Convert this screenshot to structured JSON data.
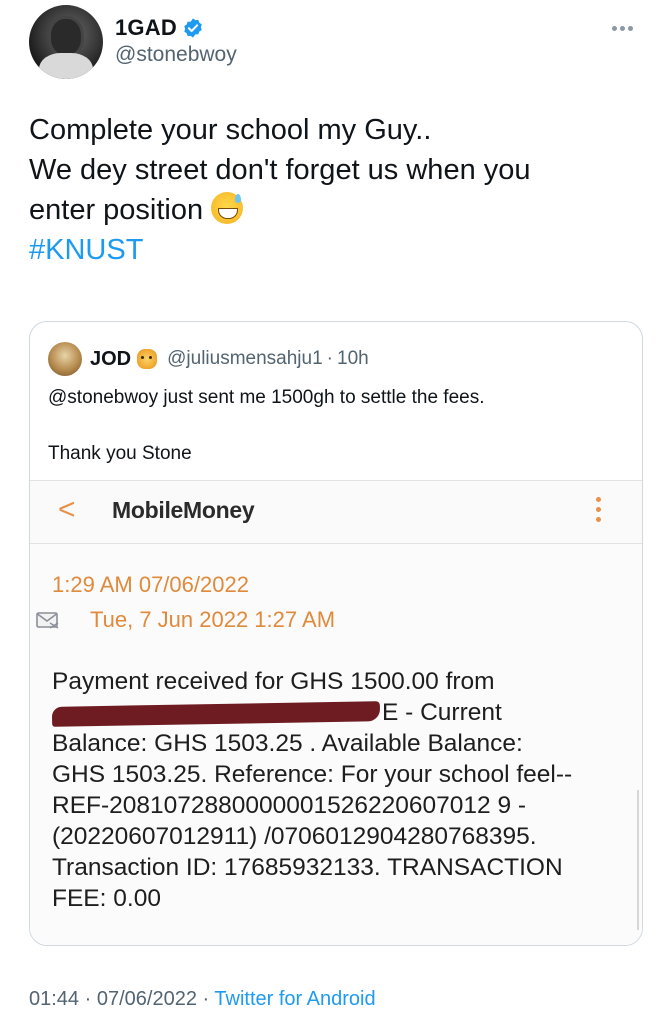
{
  "author": {
    "name": "1GAD",
    "handle": "@stonebwoy"
  },
  "tweet": {
    "lines": [
      "Complete your school my Guy..",
      "We dey street don't forget us when you",
      "enter position"
    ],
    "hashtag": "#KNUST"
  },
  "quoted": {
    "name": "JOD",
    "handle": "@juliusmensahju1",
    "separator": "·",
    "time": "10h",
    "text_line1": "@stonebwoy just sent me 1500gh to settle the fees.",
    "text_line2": "Thank you Stone",
    "sms": {
      "back_glyph": "<",
      "app_title": "MobileMoney",
      "received_datetime": "1:29 AM  07/06/2022",
      "sent_datetime": "Tue, 7 Jun 2022 1:27 AM",
      "body_lines": [
        "Payment received for  GHS 1500.00 from",
        "E -  Current",
        "Balance: GHS 1503.25 . Available Balance:",
        "GHS 1503.25. Reference: For your school feel--",
        "REF-2081072880000001526220607012 9 -",
        "(20220607012911) /0706012904280768395.",
        "Transaction ID: 17685932133. TRANSACTION",
        "FEE: 0.00"
      ]
    }
  },
  "footer": {
    "time": "01:44",
    "sep1": "·",
    "date": "07/06/2022",
    "sep2": "·",
    "source": "Twitter for Android"
  },
  "colors": {
    "link": "#1d9bf0",
    "verified": "#1d9bf0",
    "sms_accent": "#e08a3c"
  }
}
